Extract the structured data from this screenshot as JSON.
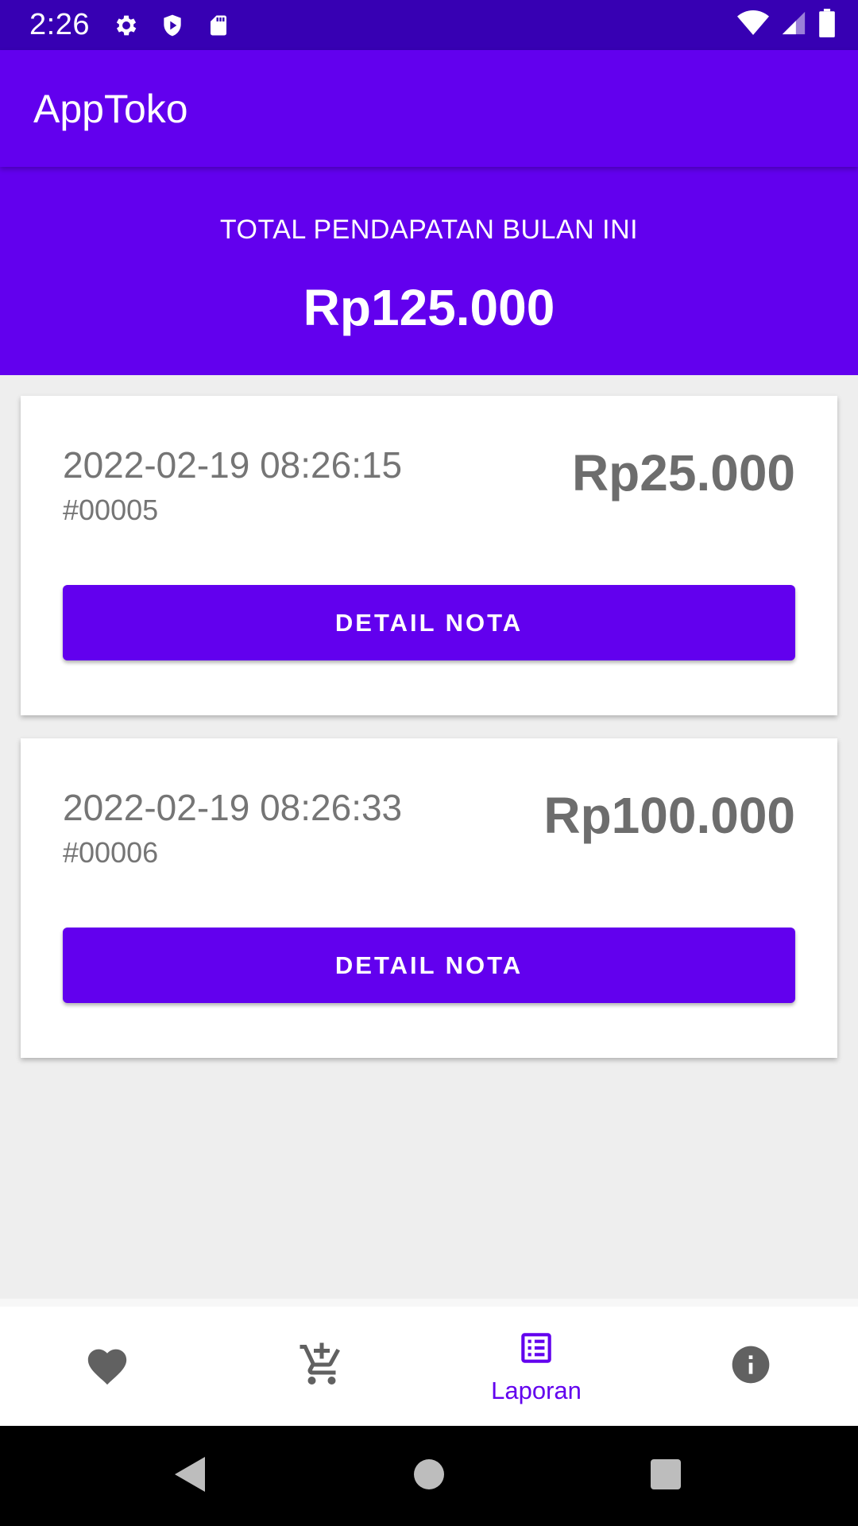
{
  "status_bar": {
    "time": "2:26",
    "left_icons": [
      "gear-icon",
      "shield-icon",
      "sd-card-icon"
    ],
    "right_icons": [
      "wifi-icon",
      "signal-icon",
      "battery-icon"
    ]
  },
  "app_bar": {
    "title": "AppToko"
  },
  "revenue": {
    "label": "TOTAL PENDAPATAN BULAN INI",
    "value": "Rp125.000"
  },
  "transactions": [
    {
      "datetime": "2022-02-19 08:26:15",
      "id": "#00005",
      "amount": "Rp25.000",
      "button_label": "DETAIL NOTA"
    },
    {
      "datetime": "2022-02-19 08:26:33",
      "id": "#00006",
      "amount": "Rp100.000",
      "button_label": "DETAIL NOTA"
    }
  ],
  "bottom_nav": {
    "items": [
      {
        "icon": "heart-icon",
        "label": ""
      },
      {
        "icon": "add-cart-icon",
        "label": ""
      },
      {
        "icon": "report-list-icon",
        "label": "Laporan",
        "active": true
      },
      {
        "icon": "info-icon",
        "label": ""
      }
    ]
  },
  "colors": {
    "primary": "#6200ee",
    "primary_dark": "#3700b3",
    "inactive_icon": "#616161",
    "text_secondary": "#757575"
  }
}
